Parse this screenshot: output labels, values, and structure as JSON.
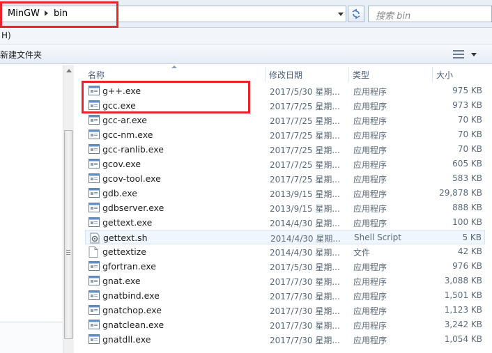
{
  "address": {
    "crumbs": [
      "MinGW",
      "bin"
    ],
    "search_placeholder": "搜索 bin"
  },
  "menu": {
    "partial_text": "H)"
  },
  "toolbar": {
    "new_folder_label": "新建文件夹"
  },
  "columns": {
    "name": "名称",
    "date": "修改日期",
    "type": "类型",
    "size": "大小"
  },
  "files": [
    {
      "name": "g++.exe",
      "date": "2017/5/30 星期...",
      "type": "应用程序",
      "size": "975 KB",
      "icon": "exe-icon"
    },
    {
      "name": "gcc.exe",
      "date": "2017/7/25 星期...",
      "type": "应用程序",
      "size": "973 KB",
      "icon": "exe-icon"
    },
    {
      "name": "gcc-ar.exe",
      "date": "2017/7/25 星期...",
      "type": "应用程序",
      "size": "70 KB",
      "icon": "exe-icon"
    },
    {
      "name": "gcc-nm.exe",
      "date": "2017/7/25 星期...",
      "type": "应用程序",
      "size": "70 KB",
      "icon": "exe-icon"
    },
    {
      "name": "gcc-ranlib.exe",
      "date": "2017/7/25 星期...",
      "type": "应用程序",
      "size": "70 KB",
      "icon": "exe-icon"
    },
    {
      "name": "gcov.exe",
      "date": "2017/7/25 星期...",
      "type": "应用程序",
      "size": "605 KB",
      "icon": "exe-icon"
    },
    {
      "name": "gcov-tool.exe",
      "date": "2017/7/25 星期...",
      "type": "应用程序",
      "size": "583 KB",
      "icon": "exe-icon"
    },
    {
      "name": "gdb.exe",
      "date": "2013/9/15 星期...",
      "type": "应用程序",
      "size": "29,878 KB",
      "icon": "exe-icon"
    },
    {
      "name": "gdbserver.exe",
      "date": "2013/9/15 星期...",
      "type": "应用程序",
      "size": "888 KB",
      "icon": "exe-icon"
    },
    {
      "name": "gettext.exe",
      "date": "2014/4/30 星期...",
      "type": "应用程序",
      "size": "100 KB",
      "icon": "exe-icon"
    },
    {
      "name": "gettext.sh",
      "date": "2014/4/30 星期...",
      "type": "Shell Script",
      "size": "5 KB",
      "icon": "script-icon"
    },
    {
      "name": "gettextize",
      "date": "2014/4/30 星期...",
      "type": "文件",
      "size": "42 KB",
      "icon": "file-icon"
    },
    {
      "name": "gfortran.exe",
      "date": "2017/5/30 星期...",
      "type": "应用程序",
      "size": "976 KB",
      "icon": "exe-icon"
    },
    {
      "name": "gnat.exe",
      "date": "2017/7/30 星期...",
      "type": "应用程序",
      "size": "3,088 KB",
      "icon": "exe-icon"
    },
    {
      "name": "gnatbind.exe",
      "date": "2017/7/30 星期...",
      "type": "应用程序",
      "size": "1,501 KB",
      "icon": "exe-icon"
    },
    {
      "name": "gnatchop.exe",
      "date": "2017/7/30 星期...",
      "type": "应用程序",
      "size": "1,123 KB",
      "icon": "exe-icon"
    },
    {
      "name": "gnatclean.exe",
      "date": "2017/7/30 星期...",
      "type": "应用程序",
      "size": "3,242 KB",
      "icon": "exe-icon"
    },
    {
      "name": "gnatdll.exe",
      "date": "2017/7/30 星期...",
      "type": "应用程序",
      "size": "1,054 KB",
      "icon": "exe-icon"
    }
  ],
  "selected_file": "gettext.sh",
  "annotation_color": "#e8232a"
}
